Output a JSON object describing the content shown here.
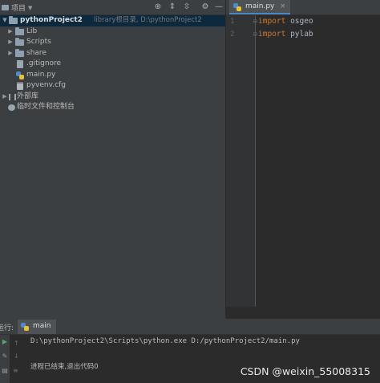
{
  "project_panel": {
    "title": "项目",
    "tree": {
      "root_name": "pythonProject2",
      "root_hint": "library根目录, D:\\pythonProject2",
      "items": [
        {
          "label": "Lib",
          "kind": "folder"
        },
        {
          "label": "Scripts",
          "kind": "folder"
        },
        {
          "label": "share",
          "kind": "folder"
        },
        {
          "label": ".gitignore",
          "kind": "file"
        },
        {
          "label": "main.py",
          "kind": "python"
        },
        {
          "label": "pyvenv.cfg",
          "kind": "config"
        }
      ],
      "external_libs": "外部库",
      "scratches": "临时文件和控制台"
    }
  },
  "editor": {
    "tab_label": "main.py",
    "lines": [
      {
        "num": "1",
        "keyword": "import",
        "module": "osgeo"
      },
      {
        "num": "2",
        "keyword": "import",
        "module": "pylab"
      }
    ]
  },
  "run_panel": {
    "label": "运行:",
    "tab_label": "main",
    "command": "D:\\pythonProject2\\Scripts\\python.exe D:/pythonProject2/main.py",
    "exit_message": "进程已结束,退出代码0"
  },
  "watermark": "CSDN @weixin_55008315",
  "colors": {
    "keyword": "#cc7832",
    "selection": "#0d293e",
    "panel": "#3c3f41",
    "editor": "#2b2b2b"
  }
}
